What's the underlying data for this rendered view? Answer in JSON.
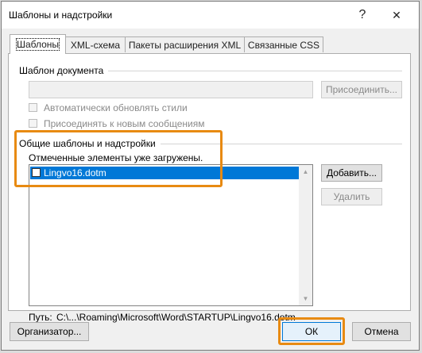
{
  "window": {
    "title": "Шаблоны и надстройки",
    "help_glyph": "?",
    "close_glyph": "✕"
  },
  "tabs": [
    {
      "label": "Шаблоны",
      "active": true
    },
    {
      "label": "XML-схема",
      "active": false
    },
    {
      "label": "Пакеты расширения XML",
      "active": false
    },
    {
      "label": "Связанные CSS",
      "active": false
    }
  ],
  "template_group": {
    "label": "Шаблон документа",
    "value": "",
    "attach_label": "Присоединить...",
    "auto_update_label": "Автоматически обновлять стили",
    "attach_to_new_label": "Присоединять к новым сообщениям"
  },
  "global_group": {
    "label": "Общие шаблоны и надстройки",
    "hint": "Отмеченные элементы уже загружены.",
    "items": [
      {
        "name": "Lingvo16.dotm",
        "checked": false,
        "selected": true
      }
    ],
    "add_label": "Добавить...",
    "remove_label": "Удалить",
    "path_label": "Путь:",
    "path_value": "C:\\...\\Roaming\\Microsoft\\Word\\STARTUP\\Lingvo16.dotm"
  },
  "footer": {
    "organizer_label": "Организатор...",
    "ok_label": "ОК",
    "cancel_label": "Отмена"
  },
  "colors": {
    "selection": "#0078d7",
    "highlight": "#e88a12"
  }
}
